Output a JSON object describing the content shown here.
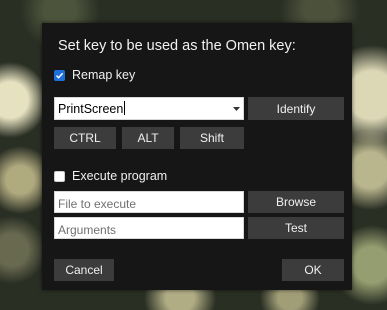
{
  "dialog": {
    "title": "Set key to be used as the Omen key:",
    "remap": {
      "label": "Remap key",
      "checked": true
    },
    "key_combo": {
      "value": "PrintScreen"
    },
    "identify_label": "Identify",
    "modifiers": [
      {
        "label": "CTRL"
      },
      {
        "label": "ALT"
      },
      {
        "label": "Shift"
      }
    ],
    "execute": {
      "label": "Execute program",
      "checked": false
    },
    "file_field": {
      "placeholder": "File to execute",
      "value": ""
    },
    "args_field": {
      "placeholder": "Arguments",
      "value": ""
    },
    "browse_label": "Browse",
    "test_label": "Test",
    "cancel_label": "Cancel",
    "ok_label": "OK"
  },
  "colors": {
    "dialog_bg": "#161616",
    "button_bg": "#3c3c3c",
    "checkbox_accent": "#1e6fd9"
  },
  "icons": [
    "checkmark-icon",
    "dropdown-arrow-icon"
  ]
}
